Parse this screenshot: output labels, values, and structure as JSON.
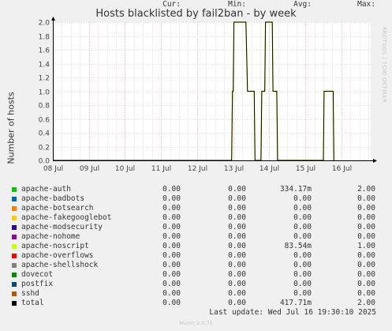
{
  "chart_data": {
    "type": "line",
    "title": "Hosts blacklisted by fail2ban - by week",
    "ylabel": "Number of hosts",
    "side_label": "RRDTOOL / TOBI OETIKER",
    "ylim": [
      0,
      2
    ],
    "yticks": [
      "0.0",
      "0.2",
      "0.4",
      "0.6",
      "0.8",
      "1.0",
      "1.2",
      "1.4",
      "1.6",
      "1.8",
      "2.0"
    ],
    "xlim": [
      "2025-07-08 00:00",
      "2025-07-16 19:30"
    ],
    "xticks": [
      {
        "t": "2025-07-08 00:00",
        "label": "08 Jul"
      },
      {
        "t": "2025-07-09 00:00",
        "label": "09 Jul"
      },
      {
        "t": "2025-07-10 00:00",
        "label": "10 Jul"
      },
      {
        "t": "2025-07-11 00:00",
        "label": "11 Jul"
      },
      {
        "t": "2025-07-12 00:00",
        "label": "12 Jul"
      },
      {
        "t": "2025-07-13 00:00",
        "label": "13 Jul"
      },
      {
        "t": "2025-07-14 00:00",
        "label": "14 Jul"
      },
      {
        "t": "2025-07-15 00:00",
        "label": "15 Jul"
      },
      {
        "t": "2025-07-16 00:00",
        "label": "16 Jul"
      }
    ],
    "grid": true,
    "series": [
      {
        "name": "apache-noscript",
        "color": "#ccff00",
        "points": [
          [
            "2025-07-12 23:00",
            0
          ],
          [
            "2025-07-12 23:30",
            1
          ],
          [
            "2025-07-13 00:00",
            1
          ],
          [
            "2025-07-13 00:30",
            2
          ],
          [
            "2025-07-13 06:00",
            2
          ],
          [
            "2025-07-13 08:30",
            2
          ],
          [
            "2025-07-13 09:30",
            1
          ],
          [
            "2025-07-13 14:00",
            1
          ],
          [
            "2025-07-13 14:30",
            0
          ],
          [
            "2025-07-13 18:30",
            0
          ],
          [
            "2025-07-13 19:00",
            1
          ],
          [
            "2025-07-13 21:00",
            1
          ],
          [
            "2025-07-13 21:30",
            2
          ],
          [
            "2025-07-14 02:00",
            2
          ],
          [
            "2025-07-14 02:30",
            1
          ],
          [
            "2025-07-14 05:00",
            1
          ],
          [
            "2025-07-14 05:30",
            0
          ],
          [
            "2025-07-15 12:00",
            0
          ],
          [
            "2025-07-15 12:30",
            1
          ],
          [
            "2025-07-15 18:00",
            1
          ],
          [
            "2025-07-15 18:30",
            1
          ],
          [
            "2025-07-15 19:00",
            0
          ]
        ]
      },
      {
        "name": "total",
        "color": "#000000",
        "points": [
          [
            "2025-07-08 00:00",
            0
          ],
          [
            "2025-07-12 23:00",
            0
          ],
          [
            "2025-07-12 23:30",
            1
          ],
          [
            "2025-07-13 00:00",
            1
          ],
          [
            "2025-07-13 00:30",
            2
          ],
          [
            "2025-07-13 08:30",
            2
          ],
          [
            "2025-07-13 09:30",
            1
          ],
          [
            "2025-07-13 14:00",
            1
          ],
          [
            "2025-07-13 14:30",
            0
          ],
          [
            "2025-07-13 18:30",
            0
          ],
          [
            "2025-07-13 19:00",
            1
          ],
          [
            "2025-07-13 21:00",
            1
          ],
          [
            "2025-07-13 21:30",
            2
          ],
          [
            "2025-07-14 02:00",
            2
          ],
          [
            "2025-07-14 02:30",
            1
          ],
          [
            "2025-07-14 05:00",
            1
          ],
          [
            "2025-07-14 05:30",
            0
          ],
          [
            "2025-07-15 12:00",
            0
          ],
          [
            "2025-07-15 12:30",
            1
          ],
          [
            "2025-07-15 18:30",
            1
          ],
          [
            "2025-07-15 19:00",
            0
          ]
        ]
      }
    ]
  },
  "legend": {
    "headers": {
      "cur": "Cur:",
      "min": "Min:",
      "avg": "Avg:",
      "max": "Max:"
    },
    "rows": [
      {
        "name": "apache-auth",
        "color": "#00cc00",
        "cur": "0.00",
        "min": "0.00",
        "avg": "334.17m",
        "max": "2.00"
      },
      {
        "name": "apache-badbots",
        "color": "#0066b3",
        "cur": "0.00",
        "min": "0.00",
        "avg": "0.00",
        "max": "0.00"
      },
      {
        "name": "apache-botsearch",
        "color": "#ff8000",
        "cur": "0.00",
        "min": "0.00",
        "avg": "0.00",
        "max": "0.00"
      },
      {
        "name": "apache-fakegooglebot",
        "color": "#ffcc00",
        "cur": "0.00",
        "min": "0.00",
        "avg": "0.00",
        "max": "0.00"
      },
      {
        "name": "apache-modsecurity",
        "color": "#330099",
        "cur": "0.00",
        "min": "0.00",
        "avg": "0.00",
        "max": "0.00"
      },
      {
        "name": "apache-nohome",
        "color": "#990099",
        "cur": "0.00",
        "min": "0.00",
        "avg": "0.00",
        "max": "0.00"
      },
      {
        "name": "apache-noscript",
        "color": "#ccff00",
        "cur": "0.00",
        "min": "0.00",
        "avg": "83.54m",
        "max": "1.00"
      },
      {
        "name": "apache-overflows",
        "color": "#ff0000",
        "cur": "0.00",
        "min": "0.00",
        "avg": "0.00",
        "max": "0.00"
      },
      {
        "name": "apache-shellshock",
        "color": "#808080",
        "cur": "0.00",
        "min": "0.00",
        "avg": "0.00",
        "max": "0.00"
      },
      {
        "name": "dovecot",
        "color": "#008f00",
        "cur": "0.00",
        "min": "0.00",
        "avg": "0.00",
        "max": "0.00"
      },
      {
        "name": "postfix",
        "color": "#00487d",
        "cur": "0.00",
        "min": "0.00",
        "avg": "0.00",
        "max": "0.00"
      },
      {
        "name": "sshd",
        "color": "#b35a00",
        "cur": "0.00",
        "min": "0.00",
        "avg": "0.00",
        "max": "0.00"
      },
      {
        "name": "total",
        "color": "#000000",
        "cur": "0.00",
        "min": "0.00",
        "avg": "417.71m",
        "max": "2.00"
      }
    ]
  },
  "last_update": "Last update: Wed Jul 16 19:30:10 2025",
  "footer": "Munin 2.0.71"
}
